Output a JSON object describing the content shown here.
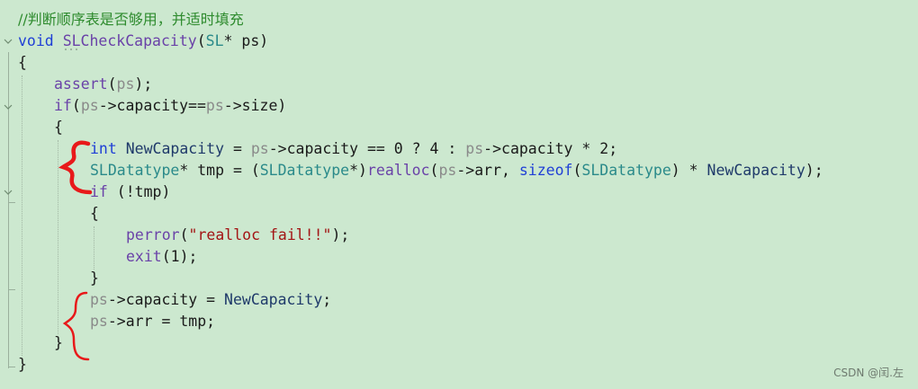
{
  "code": {
    "comment": "//判断顺序表是否够用，并适时填充",
    "line1": {
      "kw": "void",
      "name": "SLCheckCapacity",
      "open": "(",
      "type": "SL",
      "rest": "* ps)"
    },
    "line2": "{",
    "line3": {
      "fn": "assert",
      "open": "(",
      "var": "ps",
      "close": ");"
    },
    "line4": {
      "kw": "if",
      "open": "(",
      "var1": "ps",
      "mid": "->capacity==",
      "var2": "ps",
      "end": "->size)"
    },
    "line5": "{",
    "line6": {
      "kw": "int",
      "id": "NewCapacity",
      "eq": " = ",
      "var1": "ps",
      "mid": "->capacity == 0 ? 4 : ",
      "var2": "ps",
      "end": "->capacity * 2;"
    },
    "line7": {
      "ty1": "SLDatatype",
      "p1": "* tmp = (",
      "ty2": "SLDatatype",
      "p2": "*)",
      "fn": "realloc",
      "p3": "(",
      "var": "ps",
      "p4": "->arr, ",
      "kw": "sizeof",
      "p5": "(",
      "ty3": "SLDatatype",
      "p6": ") * ",
      "id": "NewCapacity",
      "p7": ");"
    },
    "line8": {
      "kw": "if",
      "rest": " (!tmp)"
    },
    "line9": "{",
    "line10": {
      "fn": "perror",
      "open": "(",
      "str": "\"realloc fail!!\"",
      "close": ");"
    },
    "line11": {
      "fn": "exit",
      "rest": "(1);"
    },
    "line12": "}",
    "line13": {
      "var": "ps",
      "mid": "->capacity = ",
      "id": "NewCapacity",
      "end": ";"
    },
    "line14": {
      "var": "ps",
      "rest": "->arr = tmp;"
    },
    "line15": "}",
    "line16": "}"
  },
  "watermark": "CSDN @闰.左",
  "colors": {
    "background": "#cce8cf",
    "keyword": "#1f3fd6",
    "function": "#6a42a8",
    "type": "#2a8a8a",
    "variable": "#8a8a8a",
    "comment": "#2e8b2e",
    "string": "#a31515",
    "annotation": "#e8191a"
  },
  "icons": [
    "fold-chevron-icon",
    "red-brace-annotation"
  ]
}
